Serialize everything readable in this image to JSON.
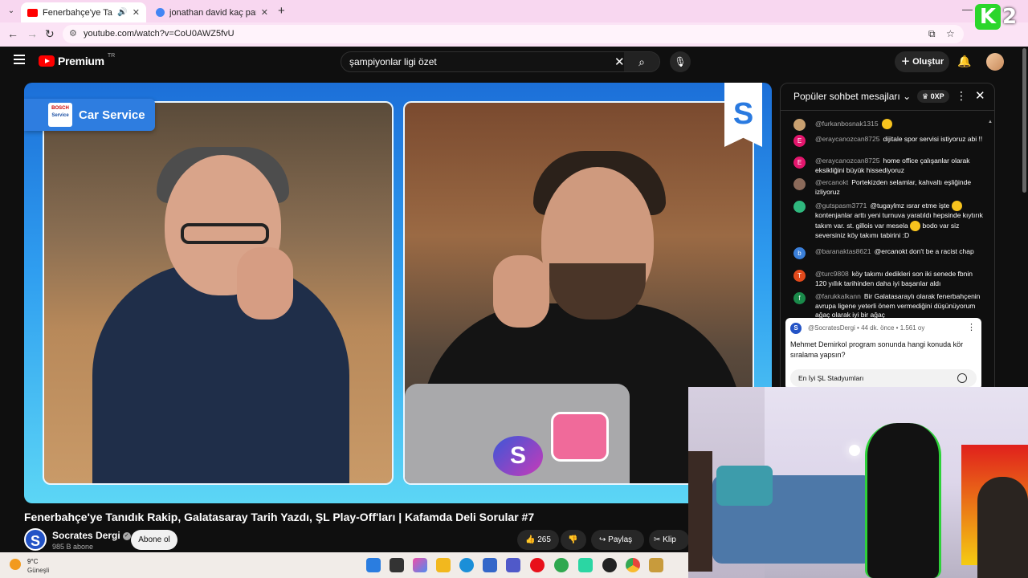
{
  "browser": {
    "tabs": [
      {
        "title": "Fenerbahçe'ye Tanıdık Rakip",
        "favicon_color": "#ff0000",
        "active": true,
        "audio": true
      },
      {
        "title": "jonathan david kaç para maaş",
        "favicon_color": "#4285f4",
        "active": false,
        "audio": false
      }
    ],
    "url": "youtube.com/watch?v=CoU0AWZ5fvU",
    "overlay_logo": {
      "letter": "K",
      "number": "2"
    }
  },
  "youtube": {
    "logo_word": "Premium",
    "logo_region": "TR",
    "search_query": "şampiyonlar ligi özet",
    "create_label": "Oluştur"
  },
  "video": {
    "sponsor_logo": [
      "BOSCH",
      "Service"
    ],
    "sponsor_text": "Car Service",
    "channel_badge_letter": "S",
    "title": "Fenerbahçe'ye Tanıdık Rakip, Galatasaray Tarih Yazdı, ŞL Play-Off'ları | Kafamda Deli Sorular #7",
    "channel_name": "Socrates Dergi",
    "channel_avatar_letter": "S",
    "subscribers": "985 B abone",
    "subscribe_label": "Abone ol",
    "likes": "265",
    "share_label": "Paylaş",
    "clip_label": "Klip"
  },
  "chat": {
    "header": "Popüler sohbet mesajları",
    "xp_label": "0XP",
    "messages": [
      {
        "author": "@furkanbosnak1315",
        "text": "",
        "avatar_letter": "",
        "avatar_color": "#c8a070",
        "emoji": true
      },
      {
        "author": "@eraycanozcan8725",
        "text": "dijitale spor servisi istiyoruz abi !!",
        "avatar_letter": "E",
        "avatar_color": "#e3166d",
        "emoji": false
      },
      {
        "author": "@eraycanozcan8725",
        "text": "home office çalışanlar olarak eksikliğini büyük hissediyoruz",
        "avatar_letter": "E",
        "avatar_color": "#e3166d",
        "emoji": false
      },
      {
        "author": "@ercanokt",
        "text": "Portekizden selamlar, kahvaltı eşliğinde izliyoruz",
        "avatar_letter": "",
        "avatar_color": "#8b6a5a",
        "emoji": false
      },
      {
        "author": "@gutspasm3771",
        "text": "@tugaylmz ısrar etme işte",
        "text2": "kontenjanlar arttı yeni turnuva yaratıldı hepsinde kıytırık takım var. st. gillois var mesela",
        "text3": "bodo var siz seversiniz köy takımı tabirini :D",
        "avatar_letter": "",
        "avatar_color": "#2fb87e",
        "emoji": true
      },
      {
        "author": "@baranaktas8621",
        "text": "@ercanokt don't be a racist chap",
        "avatar_letter": "b",
        "avatar_color": "#3a7fd9",
        "emoji": false
      },
      {
        "author": "@turc9808",
        "text": "köy takımı dedikleri son iki senede fbnin 120 yıllık tarihinden daha iyi başarılar aldı",
        "avatar_letter": "T",
        "avatar_color": "#e24a1c",
        "emoji": false
      },
      {
        "author": "@farukkalkann",
        "text": "Bir Galatasaraylı olarak fenerbahçenin avrupa ligene yeterli önem vermediğini düşünüyorum ağaç olarak iyi bir ağaç",
        "avatar_letter": "f",
        "avatar_color": "#1a8a4a",
        "emoji": false
      }
    ],
    "poll": {
      "channel": "@SocratesDergi",
      "time": "44 dk. önce",
      "votes": "1.561 oy",
      "question": "Mehmet Demirkol program sonunda hangi konuda kör sıralama yapsın?",
      "option": "En İyi ŞL Stadyumları"
    }
  },
  "taskbar": {
    "temperature": "9°C",
    "weather": "Güneşli"
  }
}
